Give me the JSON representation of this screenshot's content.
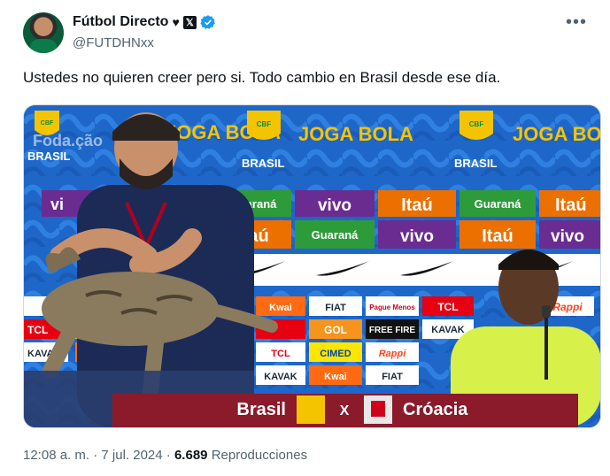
{
  "tweet": {
    "display_name": "Fútbol Directo",
    "handle": "@FUTDHNxx",
    "text": "Ustedes no quieren creer pero si. Todo cambio en Brasil desde ese día.",
    "more_icon": "more-icon"
  },
  "media": {
    "sponsor_row1": [
      "JOGA BOLA",
      "JOGA BOLA",
      "JOGA BO"
    ],
    "brasil_label": "BRASIL",
    "cbf": "CBF",
    "guarana": "Guaraná",
    "vivo": "vivo",
    "itau": "Itaú",
    "kwai": "Kwai",
    "fiat": "FIAT",
    "pague_menos": "Pague Menos",
    "tcl": "TCL",
    "rappi": "Rappi",
    "gol": "GOL",
    "freefire": "FREE FIRE",
    "cimed": "CIMED",
    "kavak": "KAVAK",
    "banner_left": "Brasil",
    "banner_x": "X",
    "banner_right": "Cróacia",
    "watermark": "Foda.ção",
    "colors": {
      "panel": "#1e67c9",
      "yellow": "#f5c400",
      "green": "#0f8a3b",
      "banner": "#8b1a2b"
    }
  },
  "meta": {
    "time": "12:08 a. m.",
    "sep1": "·",
    "date": "7 jul. 2024",
    "sep2": "·",
    "views": "6.689",
    "views_label": "Reproducciones"
  }
}
